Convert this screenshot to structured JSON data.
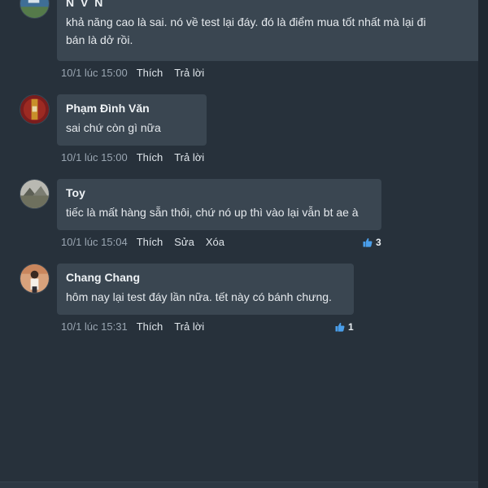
{
  "colors": {
    "background": "#27313b",
    "bubble": "#3a4651",
    "like_blue": "#4a9eea"
  },
  "comments": [
    {
      "author": "N V N",
      "text_lines": [
        "khả năng cao là sai. nó về test lại đáy. đó là điểm mua tốt nhất mà lại đi",
        "bán là dở rồi."
      ],
      "time": "10/1 lúc 15:00",
      "actions": [
        "Thích",
        "Trả lời"
      ]
    },
    {
      "author": "Phạm Đình Văn",
      "text_lines": [
        "sai chứ còn gì nữa"
      ],
      "time": "10/1 lúc 15:00",
      "actions": [
        "Thích",
        "Trả lời"
      ]
    },
    {
      "author": "Toy",
      "text_lines": [
        "tiếc là mất hàng sẵn thôi, chứ nó up thì vào lại vẫn bt ae à"
      ],
      "time": "10/1 lúc 15:04",
      "actions": [
        "Thích",
        "Sửa",
        "Xóa"
      ],
      "likes": "3"
    },
    {
      "author": "Chang Chang",
      "text_lines": [
        "hôm nay lại test đáy lần nữa. tết này có bánh chưng."
      ],
      "time": "10/1 lúc 15:31",
      "actions": [
        "Thích",
        "Trả lời"
      ],
      "likes": "1"
    }
  ]
}
